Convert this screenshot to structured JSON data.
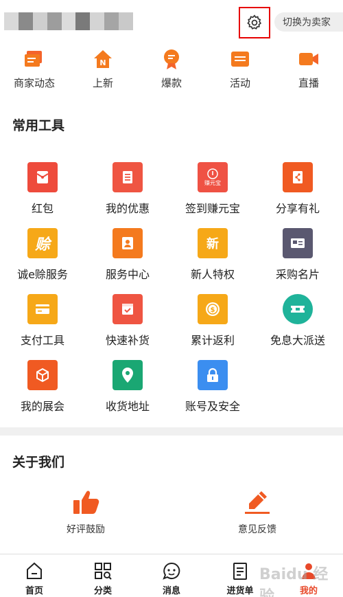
{
  "header": {
    "switch_label": "切换为卖家",
    "blur_colors": [
      "#d9d9d9",
      "#8a8a8a",
      "#cfcfcf",
      "#9d9d9d",
      "#dcdcdc",
      "#7a7a7a",
      "#d4d4d4",
      "#a5a5a5",
      "#c9c9c9"
    ]
  },
  "quick": [
    {
      "label": "商家动态",
      "icon": "store-news-icon"
    },
    {
      "label": "上新",
      "icon": "new-house-icon"
    },
    {
      "label": "爆款",
      "icon": "hot-badge-icon"
    },
    {
      "label": "活动",
      "icon": "activity-ticket-icon"
    },
    {
      "label": "直播",
      "icon": "live-camera-icon"
    }
  ],
  "tools": {
    "title": "常用工具",
    "items": [
      {
        "label": "红包",
        "color": "#ee4b3c",
        "icon": "red-envelope-icon"
      },
      {
        "label": "我的优惠",
        "color": "#ef5542",
        "icon": "coupon-icon"
      },
      {
        "label": "签到赚元宝",
        "color": "#ef5244",
        "icon": "checkin-icon",
        "inner": "赚元宝"
      },
      {
        "label": "分享有礼",
        "color": "#f05a22",
        "icon": "share-gift-icon"
      },
      {
        "label": "诚e赊服务",
        "color": "#f6a818",
        "icon": "credit-service-icon",
        "inner": "赊"
      },
      {
        "label": "服务中心",
        "color": "#f47a1e",
        "icon": "service-center-icon"
      },
      {
        "label": "新人特权",
        "color": "#f6a818",
        "icon": "newcomer-icon",
        "inner": "新"
      },
      {
        "label": "采购名片",
        "color": "#5a5870",
        "icon": "business-card-icon"
      },
      {
        "label": "支付工具",
        "color": "#f6a818",
        "icon": "payment-card-icon"
      },
      {
        "label": "快速补货",
        "color": "#ef5542",
        "icon": "restock-box-icon"
      },
      {
        "label": "累计返利",
        "color": "#f6a818",
        "icon": "rebate-coin-icon"
      },
      {
        "label": "免息大派送",
        "color": "#1fb39a",
        "icon": "interest-free-ticket-icon"
      },
      {
        "label": "我的展会",
        "color": "#f05a22",
        "icon": "expo-cube-icon"
      },
      {
        "label": "收货地址",
        "color": "#1aa773",
        "icon": "location-pin-icon"
      },
      {
        "label": "账号及安全",
        "color": "#3b8ef0",
        "icon": "lock-icon"
      }
    ]
  },
  "about": {
    "title": "关于我们",
    "items": [
      {
        "label": "好评鼓励",
        "icon": "thumbs-up-icon"
      },
      {
        "label": "意见反馈",
        "icon": "feedback-pen-icon"
      }
    ]
  },
  "nav": [
    {
      "label": "首页",
      "icon": "home-icon"
    },
    {
      "label": "分类",
      "icon": "category-icon"
    },
    {
      "label": "消息",
      "icon": "message-icon"
    },
    {
      "label": "进货单",
      "icon": "order-list-icon"
    },
    {
      "label": "我的",
      "icon": "profile-icon",
      "active": true
    }
  ],
  "watermark": "Baidu 经验"
}
